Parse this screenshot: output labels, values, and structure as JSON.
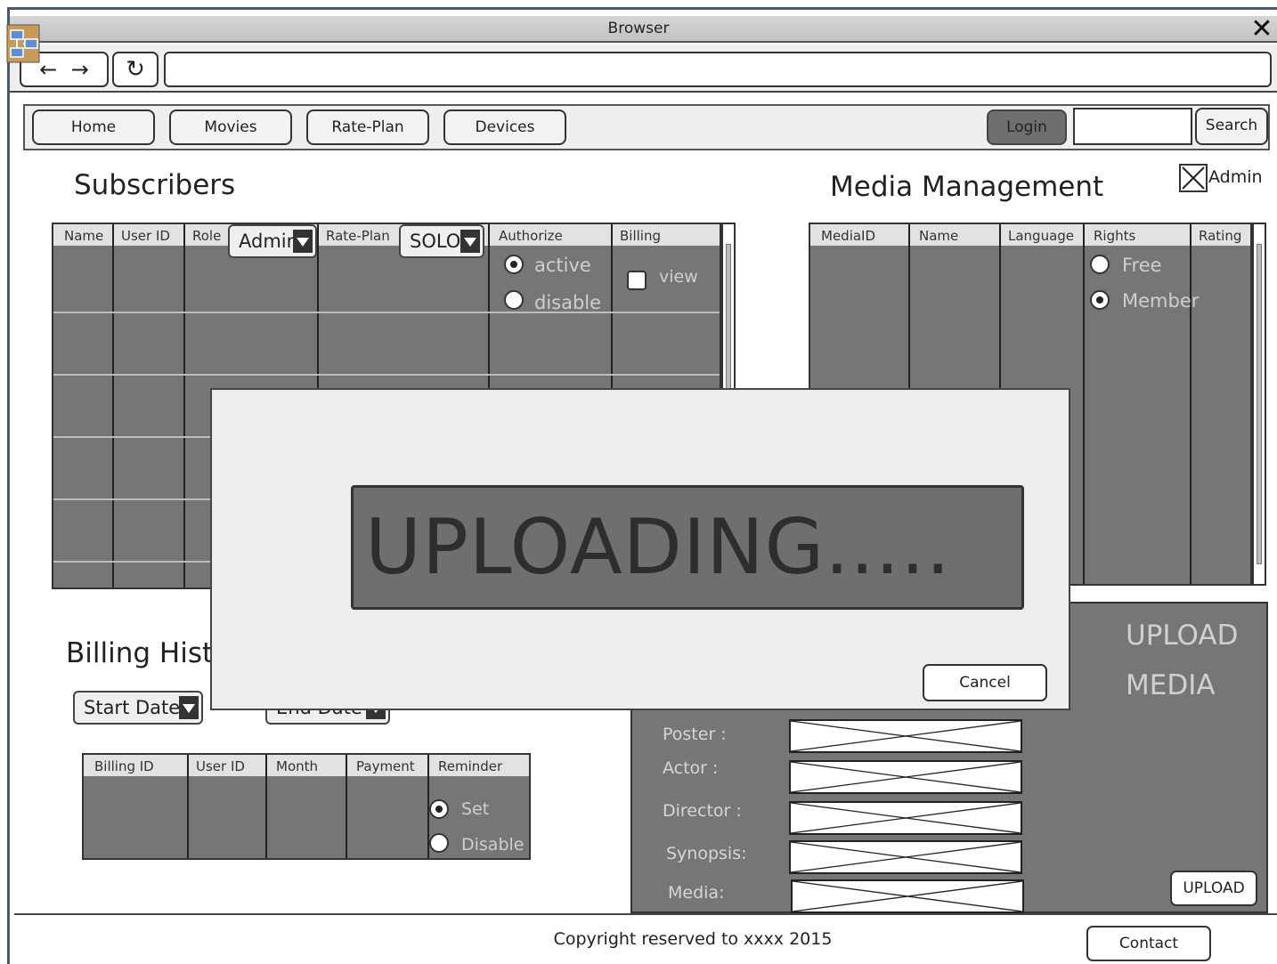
{
  "window": {
    "title": "Browser"
  },
  "nav": {
    "tabs": [
      "Home",
      "Movies",
      "Rate-Plan",
      "Devices"
    ],
    "login": "Login",
    "search": "Search"
  },
  "admin_checkbox": {
    "label": "Admin",
    "checked": true
  },
  "subscribers": {
    "title": "Subscribers",
    "columns": [
      "Name",
      "User ID",
      "Role",
      "Rate-Plan",
      "Authorize",
      "Billing"
    ],
    "role_select": "Admin",
    "rateplan_select": "SOLO",
    "authorize_options": [
      {
        "label": "active",
        "selected": true
      },
      {
        "label": "disable",
        "selected": false
      }
    ],
    "billing_checkbox": {
      "label": "view",
      "checked": false
    }
  },
  "media": {
    "title": "Media Management",
    "columns": [
      "MediaID",
      "Name",
      "Language",
      "Rights",
      "Rating"
    ],
    "rights_options": [
      {
        "label": "Free",
        "selected": false
      },
      {
        "label": "Member",
        "selected": true
      }
    ]
  },
  "billing": {
    "title": "Billing Hist",
    "start_date": "Start Date",
    "end_date": "End Date",
    "columns": [
      "Billing ID",
      "User ID",
      "Month",
      "Payment",
      "Reminder"
    ],
    "reminder_options": [
      {
        "label": "Set",
        "selected": true
      },
      {
        "label": "Disable",
        "selected": false
      }
    ]
  },
  "upload": {
    "title_line1": "UPLOAD",
    "title_line2": "MEDIA",
    "fields": [
      "Poster :",
      "Actor :",
      "Director :",
      "Synopsis:",
      "Media:"
    ],
    "button": "UPLOAD"
  },
  "modal": {
    "status_text": "UPLOADING.....",
    "cancel": "Cancel"
  },
  "footer": {
    "copyright": "Copyright reserved to xxxx 2015",
    "contact": "Contact"
  }
}
